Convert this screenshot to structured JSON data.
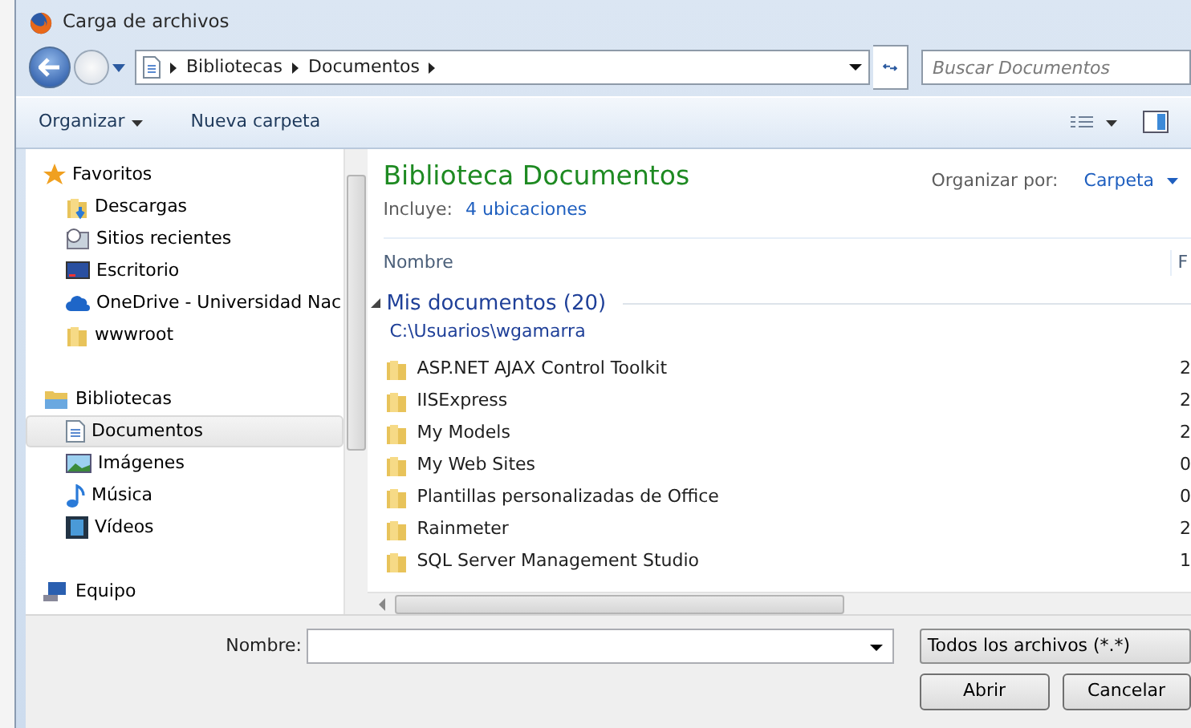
{
  "window": {
    "title": "Carga de archivos"
  },
  "address": {
    "crumbs": [
      "Bibliotecas",
      "Documentos"
    ]
  },
  "search": {
    "placeholder": "Buscar Documentos"
  },
  "toolbar": {
    "organize": "Organizar",
    "new_folder": "Nueva carpeta"
  },
  "nav": [
    {
      "label": "Favoritos",
      "children": [
        {
          "label": "Descargas",
          "selected": false
        },
        {
          "label": "Sitios recientes",
          "selected": false
        },
        {
          "label": "Escritorio",
          "selected": false
        },
        {
          "label": "OneDrive - Universidad Nac",
          "selected": false
        },
        {
          "label": "wwwroot",
          "selected": false
        }
      ]
    },
    {
      "label": "Bibliotecas",
      "children": [
        {
          "label": "Documentos",
          "selected": true
        },
        {
          "label": "Imágenes",
          "selected": false
        },
        {
          "label": "Música",
          "selected": false
        },
        {
          "label": "Vídeos",
          "selected": false
        }
      ]
    },
    {
      "label": "Equipo"
    }
  ],
  "library": {
    "title": "Biblioteca Documentos",
    "includes_label": "Incluye:",
    "includes_link": "4 ubicaciones",
    "arrange_label": "Organizar por:",
    "arrange_value": "Carpeta"
  },
  "table": {
    "columns": [
      "Nombre",
      "F"
    ],
    "group": {
      "title": "Mis documentos (20)",
      "path": "C:\\Usuarios\\wgamarra",
      "expanded": true
    },
    "rows": [
      {
        "name": "ASP.NET AJAX Control Toolkit",
        "column_2": "2"
      },
      {
        "name": "IISExpress",
        "column_2": "2"
      },
      {
        "name": "My Models",
        "column_2": "2"
      },
      {
        "name": "My Web Sites",
        "column_2": "0"
      },
      {
        "name": "Plantillas personalizadas de Office",
        "column_2": "0"
      },
      {
        "name": "Rainmeter",
        "column_2": "2"
      },
      {
        "name": "SQL Server Management Studio",
        "column_2": "1"
      }
    ]
  },
  "footer": {
    "name_label": "Nombre:",
    "filter": "Todos los archivos (*.*)",
    "buttons": [
      "Abrir",
      "Cancelar"
    ]
  }
}
